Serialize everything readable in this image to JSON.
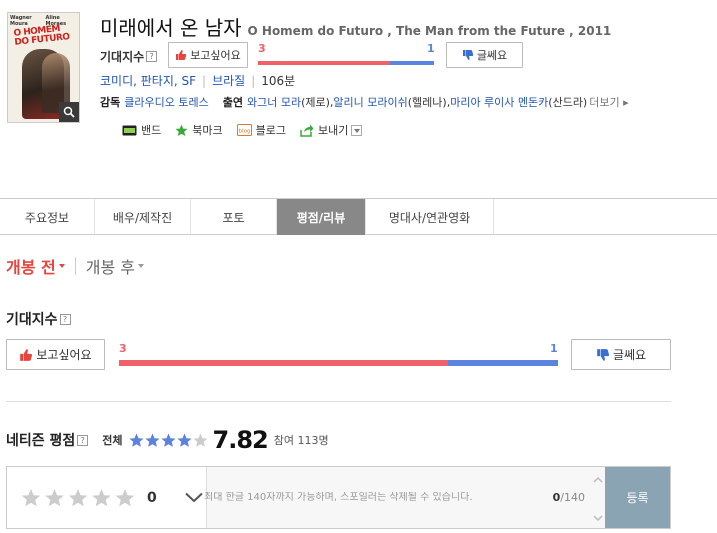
{
  "movie": {
    "title": "미래에서 온 남자",
    "subtitle": "O Homem do Futuro , The Man from the Future , 2011",
    "genres": "코미디, 판타지, SF",
    "country": "브라질",
    "runtime": "106분",
    "director_label": "감독",
    "director": "클라우디오 토레스",
    "cast_label": "출연",
    "cast": [
      {
        "name": "와그너 모라",
        "role": "(제로),"
      },
      {
        "name": "알리니 모라이쉬",
        "role": "(헬레나),"
      },
      {
        "name": "마리아 루이사 멘돈카",
        "role": "(산드라)"
      }
    ],
    "more_label": "더보기",
    "poster": {
      "top_left": "Wagner Moura",
      "top_right": "Aline Moraes",
      "title_line1": "O HOMEM",
      "title_line2": "DO FUTURO"
    }
  },
  "expectation": {
    "label": "기대지수",
    "want_label": "보고싶어요",
    "no_label": "글쎄요",
    "want_count": "3",
    "no_count": "1",
    "want_ratio": 0.75,
    "colors": {
      "want": "#f06068",
      "no": "#5b84e0"
    }
  },
  "share": [
    {
      "label": "밴드",
      "icon": "band-icon"
    },
    {
      "label": "북마크",
      "icon": "star-icon"
    },
    {
      "label": "블로그",
      "icon": "blog-icon"
    },
    {
      "label": "보내기",
      "icon": "send-icon"
    }
  ],
  "tabs": [
    {
      "label": "주요정보",
      "active": false
    },
    {
      "label": "배우/제작진",
      "active": false
    },
    {
      "label": "포토",
      "active": false
    },
    {
      "label": "평점/리뷰",
      "active": true
    },
    {
      "label": "명대사/연관영화",
      "active": false
    }
  ],
  "release_toggle": {
    "before": "개봉 전",
    "after": "개봉 후"
  },
  "expect_section": {
    "title": "기대지수"
  },
  "netizen": {
    "title": "네티즌 평점",
    "all_label": "전체",
    "score": "7.82",
    "count": "참여 113명",
    "star_fraction": 0.78
  },
  "review_box": {
    "rating_value": "0",
    "placeholder": "최대 한글 140자까지 가능하며, 스포일러는 삭제될 수 있습니다.",
    "char_count": "0",
    "char_max": "/140",
    "submit_label": "등록"
  }
}
